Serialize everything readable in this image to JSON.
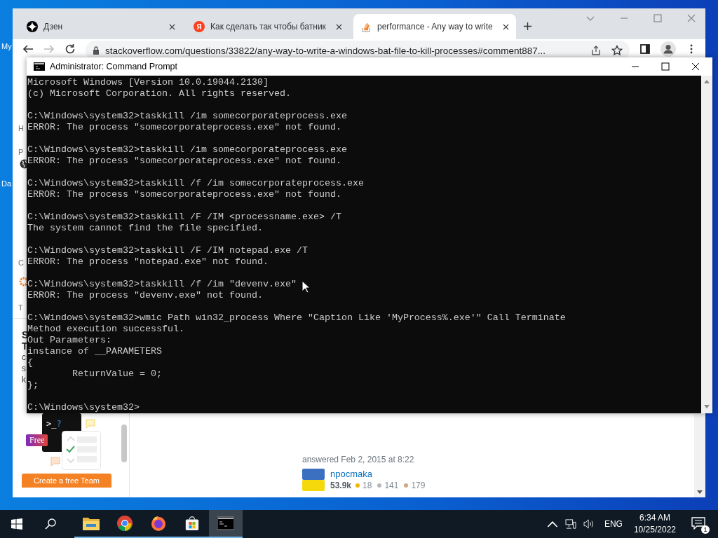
{
  "desktop": {
    "icon_labels": [
      "My",
      "Da"
    ]
  },
  "browser": {
    "tabs": [
      {
        "title": "Дзен",
        "kind": "dzen",
        "selected": false
      },
      {
        "title": "Как сделать так чтобы батник",
        "kind": "yandex",
        "badge": "Я",
        "selected": false
      },
      {
        "title": "performance - Any way to write",
        "kind": "stackoverflow",
        "selected": true
      }
    ],
    "forward_disabled": true,
    "address": "stackoverflow.com/questions/33822/any-way-to-write-a-windows-bat-file-to-kill-processes#comment887...",
    "sidebar": {
      "fragments": [
        "H",
        "P",
        "C",
        "T"
      ],
      "promo": {
        "title_fragments": [
          "S",
          "T"
        ],
        "text_fragments": [
          "c",
          "s",
          "k"
        ],
        "prompt_symbol": ">_",
        "prompt_mark": "?",
        "badge": "Free",
        "button": "Create a free Team"
      }
    },
    "answer": {
      "answered": "answered Feb 2, 2015 at 8:22",
      "user": "npocmaka",
      "reputation": "53.9k",
      "gold": "18",
      "silver": "141",
      "bronze": "179"
    }
  },
  "cmd": {
    "title": "Administrator: Command Prompt",
    "blocks": [
      [
        "Microsoft Windows [Version 10.0.19044.2130]",
        "(c) Microsoft Corporation. All rights reserved."
      ],
      [
        "C:\\Windows\\system32>taskkill /im somecorporateprocess.exe",
        "ERROR: The process \"somecorporateprocess.exe\" not found."
      ],
      [
        "C:\\Windows\\system32>taskkill /im somecorporateprocess.exe",
        "ERROR: The process \"somecorporateprocess.exe\" not found."
      ],
      [
        "C:\\Windows\\system32>taskkill /f /im somecorporateprocess.exe",
        "ERROR: The process \"somecorporateprocess.exe\" not found."
      ],
      [
        "C:\\Windows\\system32>taskkill /F /IM <processname.exe> /T",
        "The system cannot find the file specified."
      ],
      [
        "C:\\Windows\\system32>taskkill /F /IM notepad.exe /T",
        "ERROR: The process \"notepad.exe\" not found."
      ],
      [
        "C:\\Windows\\system32>taskkill /f /im \"devenv.exe\"",
        "ERROR: The process \"devenv.exe\" not found."
      ],
      [
        "C:\\Windows\\system32>wmic Path win32_process Where \"Caption Like 'MyProcess%.exe'\" Call Terminate",
        "Method execution successful.",
        "Out Parameters:",
        "instance of __PARAMETERS",
        "{",
        "        ReturnValue = 0;",
        "};"
      ],
      [
        "C:\\Windows\\system32>"
      ]
    ]
  },
  "taskbar": {
    "apps": [
      {
        "kind": "explorer",
        "running": true,
        "selected": false
      },
      {
        "kind": "chrome",
        "running": true,
        "selected": false
      },
      {
        "kind": "firefox",
        "running": true,
        "selected": false
      },
      {
        "kind": "store",
        "running": true,
        "selected": false
      },
      {
        "kind": "cmd",
        "running": true,
        "selected": true
      }
    ],
    "language": "ENG",
    "time": "6:34 AM",
    "date": "10/25/2022",
    "notifications": "1"
  }
}
